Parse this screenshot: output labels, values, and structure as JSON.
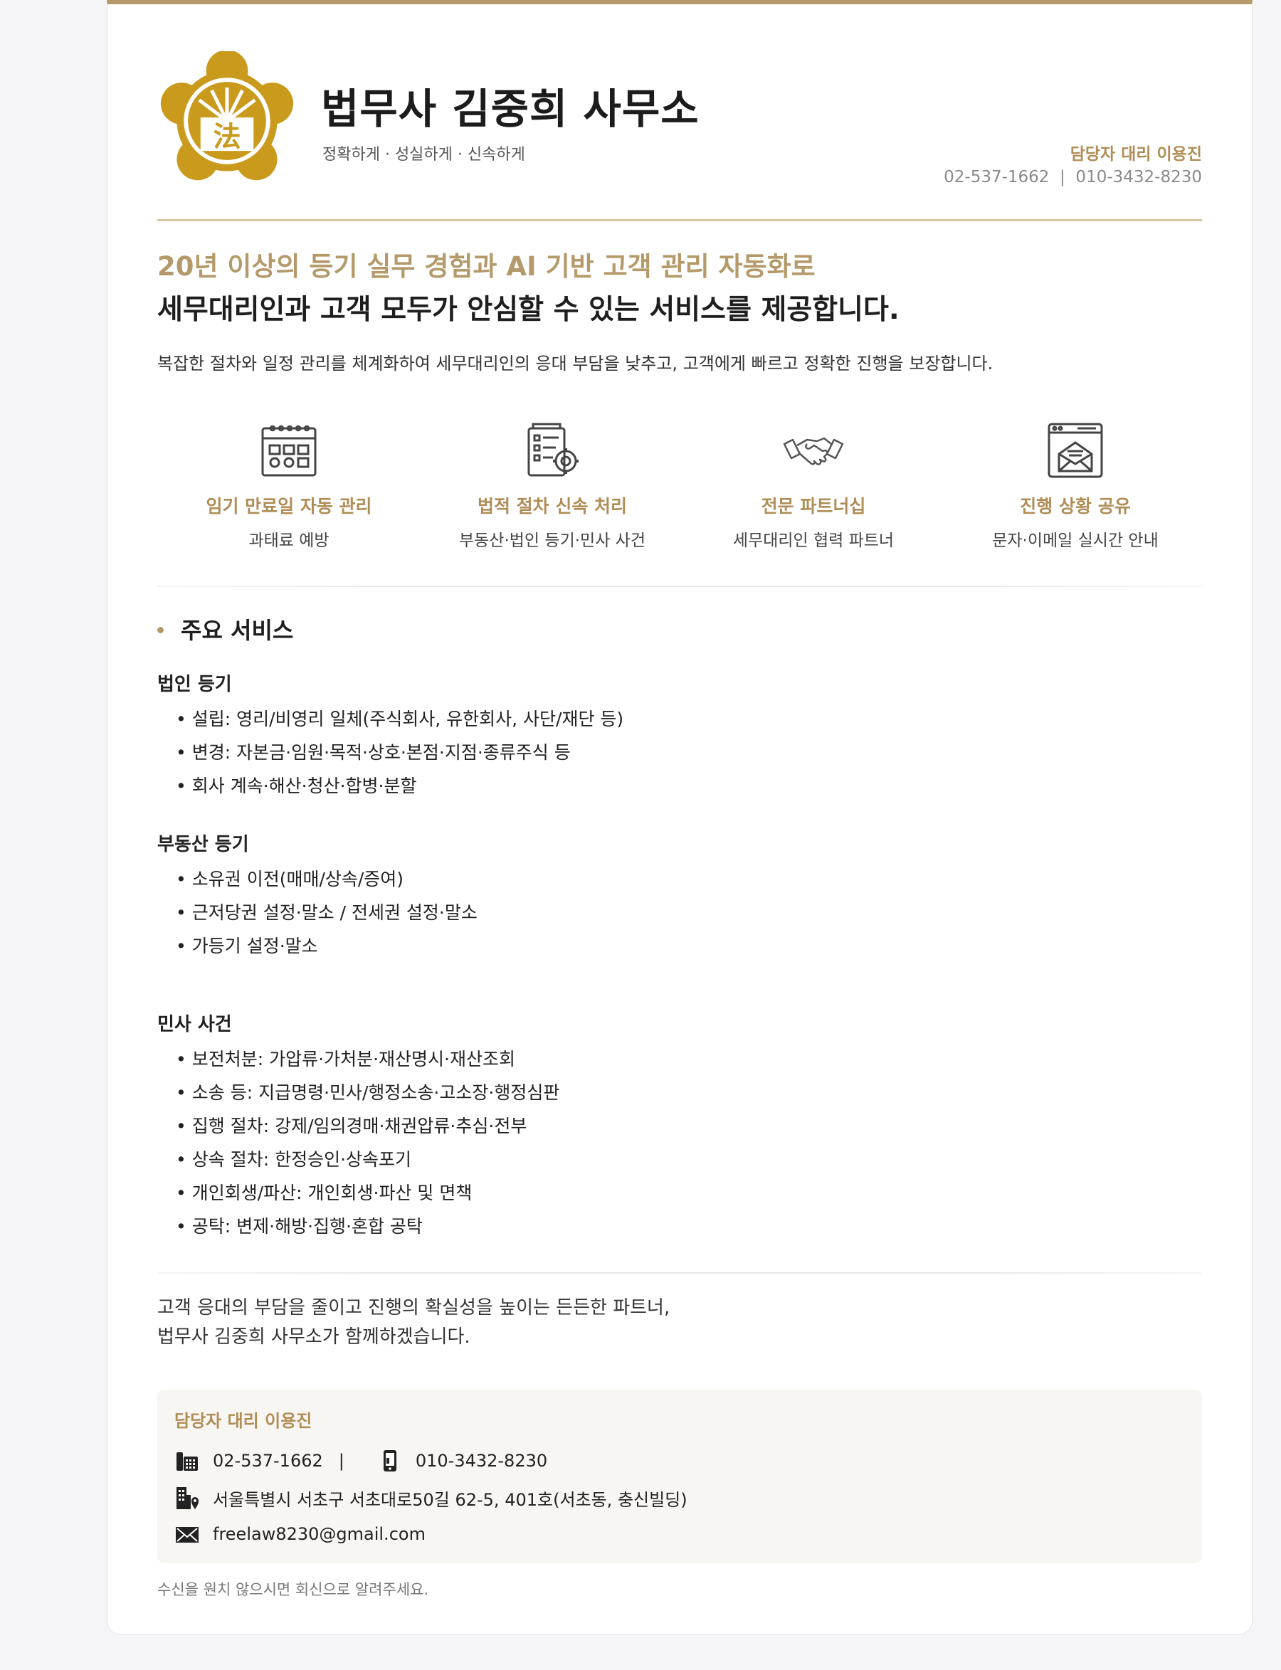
{
  "header": {
    "title": "법무사 김중희 사무소",
    "slogan": "정확하게 · 성실하게 · 신속하게",
    "contact_person": "담당자 대리 이용진",
    "phones": "02-537-1662  |  010-3432-8230",
    "logo_text": "法",
    "logo_icon": "law-seal-emblem"
  },
  "intro": {
    "lead1": "20년 이상의 등기 실무 경험과 AI 기반 고객 관리 자동화로",
    "lead2": "세무대리인과 고객 모두가 안심할 수 있는 서비스를 제공합니다.",
    "description": "복잡한 절차와 일정 관리를 체계화하여 세무대리인의 응대 부담을 낮추고, 고객에게 빠르고 정확한 진행을 보장합니다."
  },
  "features": [
    {
      "icon": "calendar-icon",
      "title": "임기 만료일 자동 관리",
      "subtitle": "과태료 예방"
    },
    {
      "icon": "document-gear-icon",
      "title": "법적 절차 신속 처리",
      "subtitle": "부동산·법인 등기·민사 사건"
    },
    {
      "icon": "handshake-icon",
      "title": "전문 파트너십",
      "subtitle": "세무대리인 협력 파트너"
    },
    {
      "icon": "mail-window-icon",
      "title": "진행 상황 공유",
      "subtitle": "문자·이메일 실시간 안내"
    }
  ],
  "services": {
    "heading": "주요 서비스",
    "groups": [
      {
        "title": "법인 등기",
        "items": [
          "설립: 영리/비영리 일체(주식회사, 유한회사, 사단/재단 등)",
          "변경: 자본금·임원·목적·상호·본점·지점·종류주식 등",
          "회사 계속·해산·청산·합병·분할"
        ]
      },
      {
        "title": "부동산 등기",
        "items": [
          "소유권 이전(매매/상속/증여)",
          "근저당권 설정·말소 / 전세권 설정·말소",
          "가등기 설정·말소"
        ]
      },
      {
        "title": "민사 사건",
        "items": [
          "보전처분: 가압류·가처분·재산명시·재산조회",
          "소송 등: 지급명령·민사/행정소송·고소장·행정심판",
          "집행 절차: 강제/임의경매·채권압류·추심·전부",
          "상속 절차: 한정승인·상속포기",
          "개인회생/파산: 개인회생·파산 및 면책",
          "공탁: 변제·해방·집행·혼합 공탁"
        ]
      }
    ]
  },
  "closing": {
    "line1": "고객 응대의 부담을 줄이고 진행의 확실성을 높이는 든든한 파트너,",
    "line2": "법무사 김중희 사무소가 함께하겠습니다."
  },
  "contact_box": {
    "name": "담당자 대리 이용진",
    "office_phone": "02-537-1662",
    "separator": "|",
    "mobile_phone": "010-3432-8230",
    "address": "서울특별시 서초구 서초대로50길 62-5, 401호(서초동, 충신빌딩)",
    "email": "freelaw8230@gmail.com"
  },
  "footer": "수신을 원치 않으시면 회신으로 알려주세요.",
  "colors": {
    "accent": "#b49a6a",
    "gold_text": "#b08d57",
    "logo_gold": "#c99a1c"
  }
}
